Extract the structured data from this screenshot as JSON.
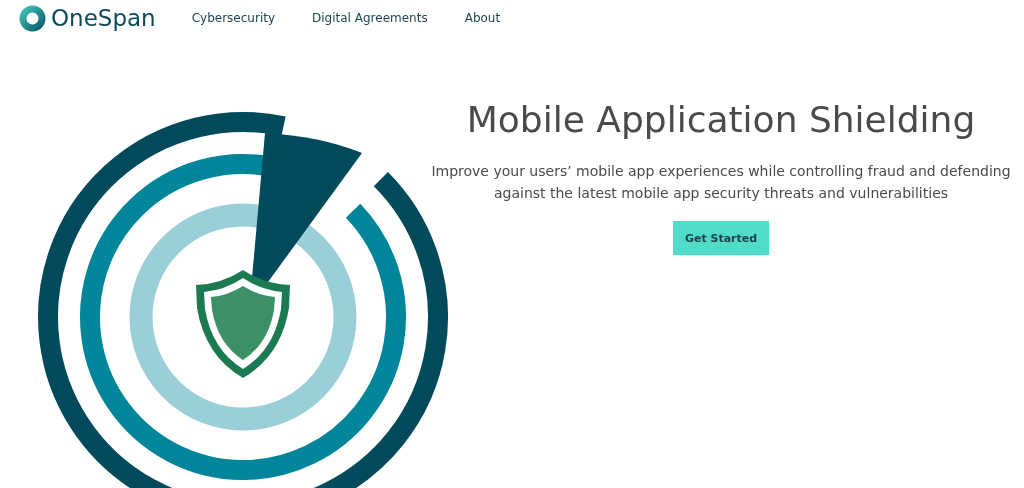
{
  "header": {
    "logo_text": "OneSpan",
    "nav": [
      {
        "label": "Cybersecurity"
      },
      {
        "label": "Digital Agreements"
      },
      {
        "label": "About"
      }
    ]
  },
  "hero": {
    "title": "Mobile Application Shielding",
    "subtitle": "Improve your users’ mobile app experiences while controlling fraud and defending against the latest mobile app security threats and vulnerabilities",
    "button": "Get Started"
  }
}
